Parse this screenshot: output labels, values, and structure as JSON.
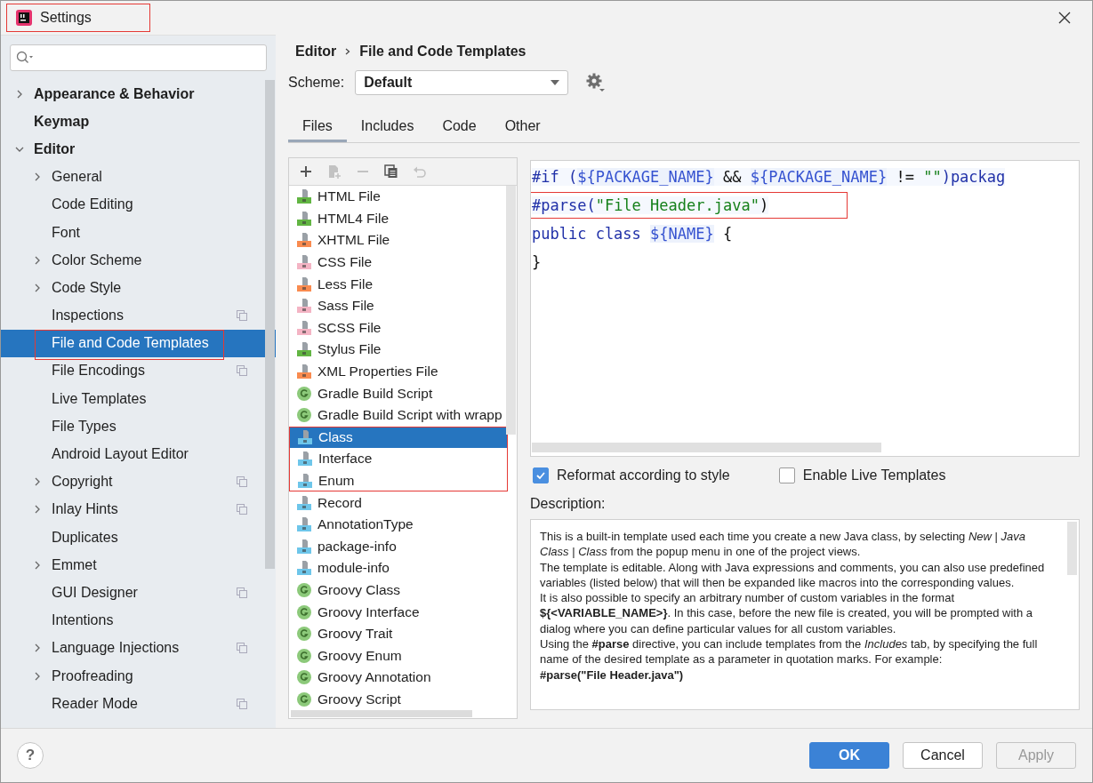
{
  "window": {
    "title": "Settings",
    "annotated": true
  },
  "sidebar": {
    "items": [
      {
        "label": "Appearance & Behavior",
        "expanded": false,
        "selected": false,
        "badge": false,
        "annotated": false
      },
      {
        "label": "Keymap",
        "selected": false,
        "badge": false,
        "annotated": false
      },
      {
        "label": "Editor",
        "expanded": true,
        "selected": false,
        "badge": false,
        "annotated": false,
        "children": [
          {
            "label": "General",
            "expanded": false,
            "selected": false,
            "badge": false,
            "annotated": false
          },
          {
            "label": "Code Editing",
            "selected": false,
            "badge": false,
            "annotated": false
          },
          {
            "label": "Font",
            "selected": false,
            "badge": false,
            "annotated": false
          },
          {
            "label": "Color Scheme",
            "expanded": false,
            "selected": false,
            "badge": false,
            "annotated": false
          },
          {
            "label": "Code Style",
            "expanded": false,
            "selected": false,
            "badge": false,
            "annotated": false
          },
          {
            "label": "Inspections",
            "selected": false,
            "badge": true,
            "annotated": false
          },
          {
            "label": "File and Code Templates",
            "selected": true,
            "badge": false,
            "annotated": true
          },
          {
            "label": "File Encodings",
            "selected": false,
            "badge": true,
            "annotated": false
          },
          {
            "label": "Live Templates",
            "selected": false,
            "badge": false,
            "annotated": false
          },
          {
            "label": "File Types",
            "selected": false,
            "badge": false,
            "annotated": false
          },
          {
            "label": "Android Layout Editor",
            "selected": false,
            "badge": false,
            "annotated": false
          },
          {
            "label": "Copyright",
            "expanded": false,
            "selected": false,
            "badge": true,
            "annotated": false
          },
          {
            "label": "Inlay Hints",
            "expanded": false,
            "selected": false,
            "badge": true,
            "annotated": false
          },
          {
            "label": "Duplicates",
            "selected": false,
            "badge": false,
            "annotated": false
          },
          {
            "label": "Emmet",
            "expanded": false,
            "selected": false,
            "badge": false,
            "annotated": false
          },
          {
            "label": "GUI Designer",
            "selected": false,
            "badge": true,
            "annotated": false
          },
          {
            "label": "Intentions",
            "selected": false,
            "badge": false,
            "annotated": false
          },
          {
            "label": "Language Injections",
            "expanded": false,
            "selected": false,
            "badge": true,
            "annotated": false
          },
          {
            "label": "Proofreading",
            "expanded": false,
            "selected": false,
            "badge": false,
            "annotated": false
          },
          {
            "label": "Reader Mode",
            "selected": false,
            "badge": true,
            "annotated": false
          }
        ]
      }
    ]
  },
  "breadcrumb": [
    "Editor",
    "File and Code Templates"
  ],
  "scheme": {
    "label": "Scheme:",
    "value": "Default"
  },
  "tabs": [
    {
      "label": "Files",
      "selected": true
    },
    {
      "label": "Includes",
      "selected": false
    },
    {
      "label": "Code",
      "selected": false
    },
    {
      "label": "Other",
      "selected": false
    }
  ],
  "toolbar": [
    {
      "kind": "add",
      "disabled": false
    },
    {
      "kind": "add-child",
      "disabled": true
    },
    {
      "kind": "remove",
      "disabled": true
    },
    {
      "kind": "copy",
      "disabled": false
    },
    {
      "kind": "reset",
      "disabled": true
    }
  ],
  "files": {
    "items": [
      {
        "label": "HTML File",
        "kind": "file",
        "color": "#62b543",
        "selected": false,
        "annotated": false
      },
      {
        "label": "HTML4 File",
        "kind": "file",
        "color": "#62b543",
        "selected": false,
        "annotated": false
      },
      {
        "label": "XHTML File",
        "kind": "file",
        "color": "#f98b4f",
        "selected": false,
        "annotated": false
      },
      {
        "label": "CSS File",
        "kind": "file",
        "color": "#f4b4c4",
        "selected": false,
        "annotated": false
      },
      {
        "label": "Less File",
        "kind": "file",
        "color": "#f98b4f",
        "selected": false,
        "annotated": false
      },
      {
        "label": "Sass File",
        "kind": "file",
        "color": "#f4b4c4",
        "selected": false,
        "annotated": false
      },
      {
        "label": "SCSS File",
        "kind": "file",
        "color": "#f4b4c4",
        "selected": false,
        "annotated": false
      },
      {
        "label": "Stylus File",
        "kind": "file",
        "color": "#62b543",
        "selected": false,
        "annotated": false
      },
      {
        "label": "XML Properties File",
        "kind": "file",
        "color": "#f98b4f",
        "selected": false,
        "annotated": false
      },
      {
        "label": "Gradle Build Script",
        "kind": "groovy",
        "color": "#8cc97a",
        "selected": false,
        "annotated": false
      },
      {
        "label": "Gradle Build Script with wrapp",
        "kind": "groovy",
        "color": "#8cc97a",
        "selected": false,
        "annotated": false
      },
      {
        "label": "Class",
        "kind": "file",
        "color": "#6ec6ea",
        "selected": true,
        "annotated": true
      },
      {
        "label": "Interface",
        "kind": "file",
        "color": "#6ec6ea",
        "selected": false,
        "annotated": true
      },
      {
        "label": "Enum",
        "kind": "file",
        "color": "#6ec6ea",
        "selected": false,
        "annotated": true
      },
      {
        "label": "Record",
        "kind": "file",
        "color": "#6ec6ea",
        "selected": false,
        "annotated": false
      },
      {
        "label": "AnnotationType",
        "kind": "file",
        "color": "#6ec6ea",
        "selected": false,
        "annotated": false
      },
      {
        "label": "package-info",
        "kind": "file",
        "color": "#6ec6ea",
        "selected": false,
        "annotated": false
      },
      {
        "label": "module-info",
        "kind": "file",
        "color": "#6ec6ea",
        "selected": false,
        "annotated": false
      },
      {
        "label": "Groovy Class",
        "kind": "groovy",
        "color": "#8cc97a",
        "selected": false,
        "annotated": false
      },
      {
        "label": "Groovy Interface",
        "kind": "groovy",
        "color": "#8cc97a",
        "selected": false,
        "annotated": false
      },
      {
        "label": "Groovy Trait",
        "kind": "groovy",
        "color": "#8cc97a",
        "selected": false,
        "annotated": false
      },
      {
        "label": "Groovy Enum",
        "kind": "groovy",
        "color": "#8cc97a",
        "selected": false,
        "annotated": false
      },
      {
        "label": "Groovy Annotation",
        "kind": "groovy",
        "color": "#8cc97a",
        "selected": false,
        "annotated": false
      },
      {
        "label": "Groovy Script",
        "kind": "groovy",
        "color": "#8cc97a",
        "selected": false,
        "annotated": false
      }
    ]
  },
  "code": {
    "lines": [
      {
        "annotated": false,
        "tokens": [
          {
            "kind": "keyword",
            "text": "#if ("
          },
          {
            "kind": "variable",
            "text": "${PACKAGE_NAME}"
          },
          {
            "kind": "plain",
            "text": " && "
          },
          {
            "kind": "variable",
            "text": "${PACKAGE_NAME}"
          },
          {
            "kind": "plain",
            "text": " != "
          },
          {
            "kind": "string",
            "text": "\"\""
          },
          {
            "kind": "keyword",
            "text": ")packag"
          }
        ]
      },
      {
        "annotated": true,
        "tokens": [
          {
            "kind": "keyword",
            "text": "#parse("
          },
          {
            "kind": "string",
            "text": "\"File Header.java\""
          },
          {
            "kind": "plain",
            "text": ")"
          }
        ]
      },
      {
        "annotated": false,
        "tokens": [
          {
            "kind": "keyword",
            "text": "public class "
          },
          {
            "kind": "variable",
            "text": "${NAME}"
          },
          {
            "kind": "plain",
            "text": " {"
          }
        ]
      },
      {
        "annotated": false,
        "tokens": [
          {
            "kind": "plain",
            "text": "}"
          }
        ]
      }
    ]
  },
  "options": [
    {
      "label": "Reformat according to style",
      "checked": true
    },
    {
      "label": "Enable Live Templates",
      "checked": false
    }
  ],
  "description": {
    "label": "Description:",
    "paragraphs": [
      {
        "text": "This is a built-in template used each time you create a new Java class, by selecting *New* | *Java Class* | *Class* from the popup menu in one of the project views.",
        "bold": false
      },
      {
        "text": "The template is editable. Along with Java expressions and comments, you can also use predefined variables (listed below) that will then be expanded like macros into the corresponding values.",
        "bold": false
      },
      {
        "text": "It is also possible to specify an arbitrary number of custom variables in the format **${<VARIABLE_NAME>}**. In this case, before the new file is created, you will be prompted with a dialog where you can define particular values for all custom variables.",
        "bold": false
      },
      {
        "text": "Using the **#parse** directive, you can include templates from the *Includes* tab, by specifying the full name of the desired template as a parameter in quotation marks. For example:",
        "bold": false
      },
      {
        "text": "#parse(\"File Header.java\")",
        "bold": true
      }
    ]
  },
  "help": "?",
  "buttons": [
    {
      "label": "OK",
      "kind": "primary",
      "disabled": false
    },
    {
      "label": "Cancel",
      "kind": "normal",
      "disabled": false
    },
    {
      "label": "Apply",
      "kind": "normal",
      "disabled": true
    }
  ]
}
